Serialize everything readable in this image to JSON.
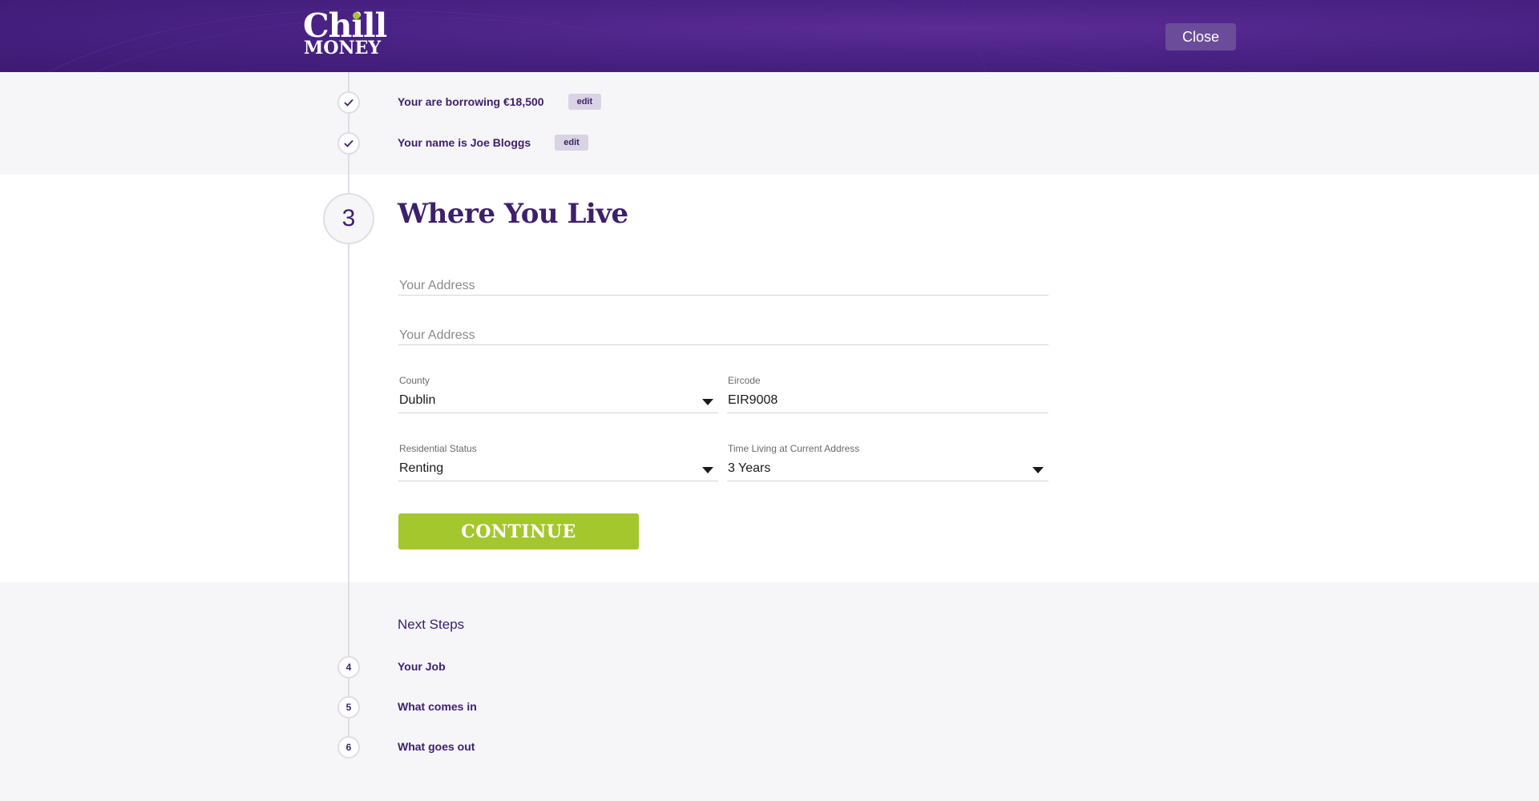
{
  "header": {
    "logo_top": "Chill",
    "logo_bottom": "MONEY",
    "close_label": "Close",
    "accent_color": "#a5c72e",
    "header_color": "#4a2285"
  },
  "completed_steps": [
    {
      "text": "Your are borrowing €18,500",
      "edit_label": "edit",
      "icon": "check-icon"
    },
    {
      "text": "Your name is Joe Bloggs",
      "edit_label": "edit",
      "icon": "check-icon"
    }
  ],
  "current_step": {
    "number": "3",
    "title": "Where You Live",
    "address_line_1": {
      "placeholder": "Your Address",
      "value": ""
    },
    "address_line_2": {
      "placeholder": "Your Address",
      "value": ""
    },
    "county": {
      "label": "County",
      "value": "Dublin"
    },
    "eircode": {
      "label": "Eircode",
      "value": "EIR9008"
    },
    "residential_status": {
      "label": "Residential Status",
      "value": "Renting"
    },
    "time_at_address": {
      "label": "Time Living at Current Address",
      "value": "3 Years"
    },
    "continue_label": "CONTINUE"
  },
  "next_steps": {
    "title": "Next Steps",
    "items": [
      {
        "number": "4",
        "label": "Your Job"
      },
      {
        "number": "5",
        "label": "What comes in"
      },
      {
        "number": "6",
        "label": "What goes out"
      }
    ]
  }
}
